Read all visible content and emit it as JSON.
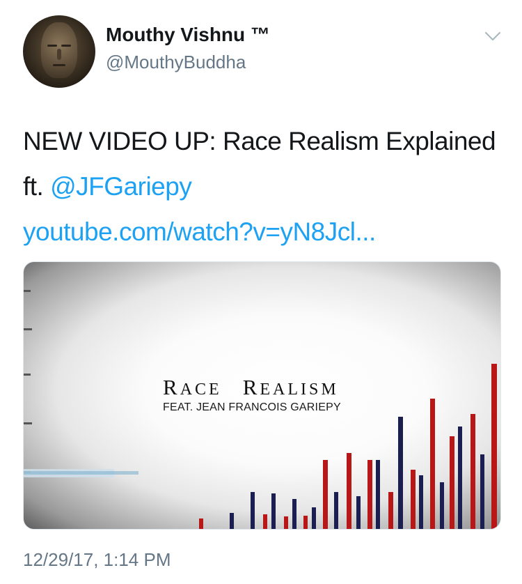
{
  "tweet": {
    "author_name": "Mouthy Vishnu ™",
    "author_handle": "@MouthyBuddha",
    "text_part1": "NEW VIDEO UP: Race Realism Explained ft. ",
    "mention": "@JFGariepy",
    "link": "youtube.com/watch?v=yN8Jcl...",
    "timestamp": "12/29/17, 1:14 PM"
  },
  "video_card": {
    "title_r1": "R",
    "title_rest1": "ACE",
    "title_r2": "R",
    "title_rest2": "EALISM",
    "subtitle": "FEAT. JEAN FRANCOIS GARIEPY"
  },
  "colors": {
    "link": "#1da1f2",
    "bar_red": "#b81717",
    "bar_navy": "#1b1f4f"
  },
  "icons": {
    "more": "chevron-down-icon"
  }
}
